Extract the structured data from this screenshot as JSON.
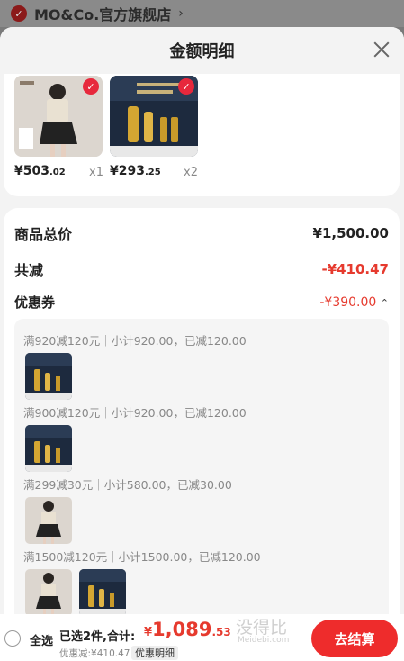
{
  "store": {
    "name": "MO&Co.官方旗舰店",
    "chevron": "›"
  },
  "sheet": {
    "title": "金额明细"
  },
  "products": [
    {
      "price_int": "¥503",
      "price_dec": ".02",
      "qty": "x1"
    },
    {
      "price_int": "¥293",
      "price_dec": ".25",
      "qty": "x2"
    }
  ],
  "summary": {
    "total_label": "商品总价",
    "total_value": "¥1,500.00",
    "reduce_label": "共减",
    "reduce_value": "-¥410.47",
    "coupon_label": "优惠券",
    "coupon_value": "-¥390.00",
    "coupon_lines": [
      "满920减120元｜小计920.00，已减120.00",
      "满900减120元｜小计920.00，已减120.00",
      "满299减30元｜小计580.00，已减30.00",
      "满1500减120元｜小计1500.00，已减120.00"
    ]
  },
  "bottom": {
    "select_all": "全选",
    "selected_text": "已选2件,合计:",
    "total_sym": "¥",
    "total_int": "1,089",
    "total_dec": ".53",
    "discount_text": "优惠减:¥410.47",
    "detail_label": "优惠明细",
    "checkout_label": "去结算",
    "watermark": "没得比",
    "watermark_sub": "Meidebi.com"
  }
}
